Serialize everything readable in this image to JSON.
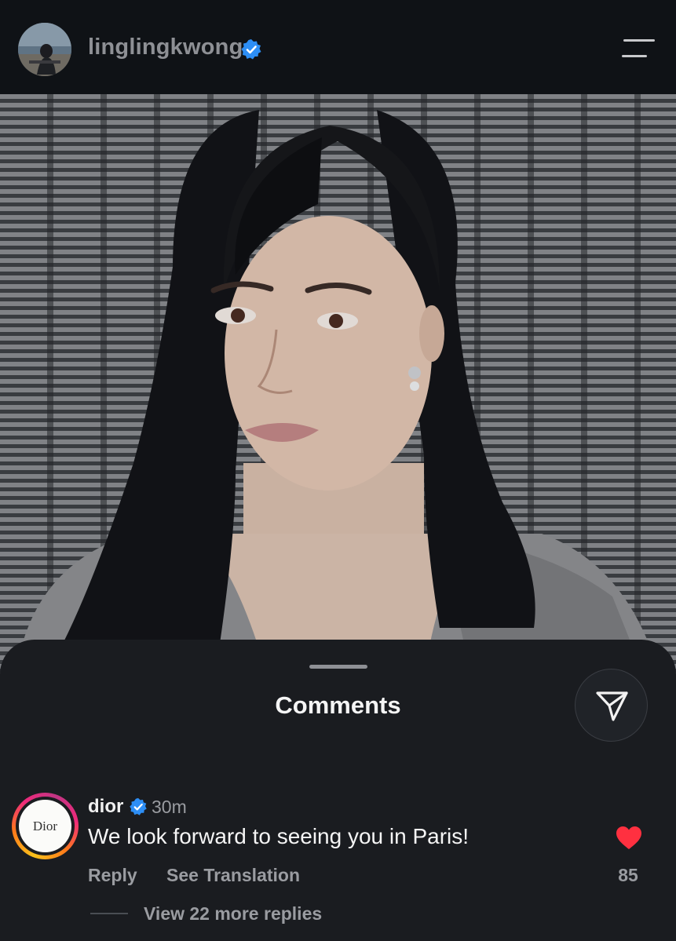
{
  "header": {
    "username": "linglingkwong",
    "verified": true,
    "avatar_icon": "profile-avatar",
    "menu_icon": "hamburger-menu-icon"
  },
  "post": {
    "image_description_icon": "post-photo"
  },
  "comments_sheet": {
    "title": "Comments",
    "share_icon": "send-icon",
    "comments": [
      {
        "username": "dior",
        "verified": true,
        "avatar_text": "Dior",
        "time": "30m",
        "text": "We look forward to seeing you in Paris!",
        "reply_label": "Reply",
        "translate_label": "See Translation",
        "liked": true,
        "likes": "85",
        "view_replies_label": "View 22 more replies"
      }
    ]
  },
  "colors": {
    "background": "#0d1014",
    "sheet": "#1a1c20",
    "verified_blue": "#2d8ef5",
    "heart_red": "#ff3040",
    "muted_text": "#9a9ca1"
  }
}
